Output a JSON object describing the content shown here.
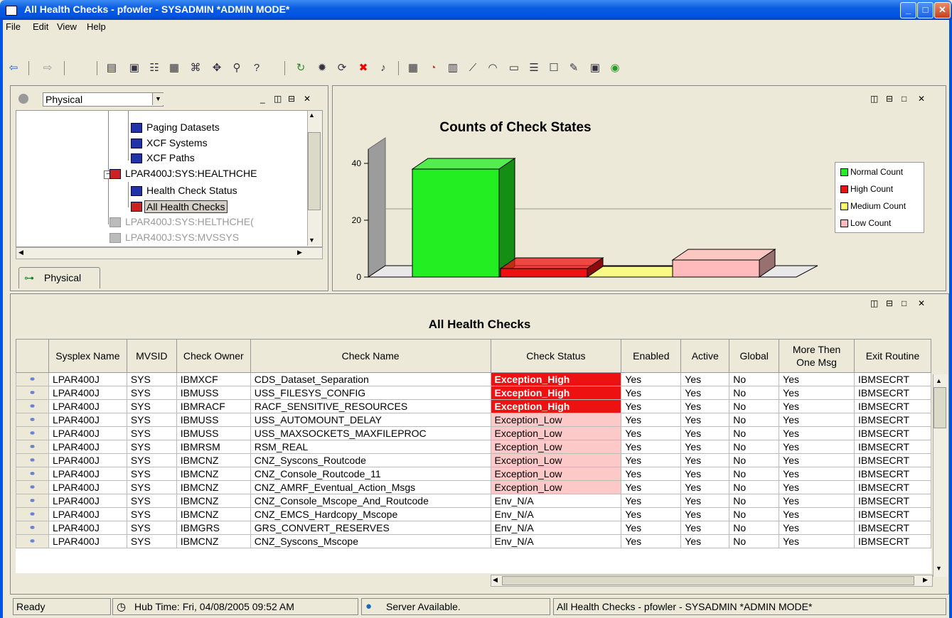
{
  "window": {
    "title": "All Health Checks - pfowler - SYSADMIN   *ADMIN MODE*"
  },
  "menu": [
    "File",
    "Edit",
    "View",
    "Help"
  ],
  "toolbar": {
    "icons": [
      "back-icon",
      "forward-icon",
      "new-icon",
      "save-icon",
      "properties-icon",
      "calendar-icon",
      "link-icon",
      "move-icon",
      "find-icon",
      "help-icon",
      "refresh-icon",
      "stop-icon",
      "reload-icon",
      "error-icon",
      "sound-icon",
      "table-icon",
      "pie-chart-icon",
      "bar-chart-icon",
      "line-chart-icon",
      "gauge-icon",
      "graph-icon",
      "report-icon",
      "notepad-icon",
      "edit-icon",
      "terminal-icon",
      "globe-icon"
    ]
  },
  "tree_panel": {
    "view": "Physical",
    "items": [
      {
        "label": "Paging Datasets",
        "state": "normal"
      },
      {
        "label": "XCF Systems",
        "state": "normal"
      },
      {
        "label": "XCF Paths",
        "state": "normal"
      },
      {
        "label": "LPAR400J:SYS:HEALTHCHE",
        "state": "normal"
      },
      {
        "label": "Health Check Status",
        "state": "normal"
      },
      {
        "label": "All Health Checks",
        "state": "selected"
      },
      {
        "label": "LPAR400J:SYS:HELTHCHE(",
        "state": "disabled"
      },
      {
        "label": "LPAR400J:SYS:MVSSYS",
        "state": "disabled"
      }
    ],
    "tab": "Physical"
  },
  "chart_data": {
    "type": "bar",
    "title": "Counts of Check States",
    "categories": [
      "Normal Count",
      "High Count",
      "Medium Count",
      "Low Count"
    ],
    "values": [
      38,
      3,
      0,
      6
    ],
    "colors": [
      "#22ee22",
      "#ee1111",
      "#ffff66",
      "#ffbbbb"
    ],
    "ylim": [
      0,
      45
    ],
    "yticks": [
      0,
      20,
      40
    ],
    "legend": [
      "Normal Count",
      "High Count",
      "Medium Count",
      "Low Count"
    ],
    "legend_position": "right",
    "grid": true
  },
  "table": {
    "title": "All Health Checks",
    "columns": [
      "",
      "Sysplex Name",
      "MVSID",
      "Check Owner",
      "Check Name",
      "Check Status",
      "Enabled",
      "Active",
      "Global",
      "More Then One Msg",
      "Exit Routine"
    ],
    "rows": [
      [
        "LPAR400J",
        "SYS",
        "IBMXCF",
        "CDS_Dataset_Separation",
        "Exception_High",
        "Yes",
        "Yes",
        "No",
        "Yes",
        "IBMSECRT"
      ],
      [
        "LPAR400J",
        "SYS",
        "IBMUSS",
        "USS_FILESYS_CONFIG",
        "Exception_High",
        "Yes",
        "Yes",
        "No",
        "Yes",
        "IBMSECRT"
      ],
      [
        "LPAR400J",
        "SYS",
        "IBMRACF",
        "RACF_SENSITIVE_RESOURCES",
        "Exception_High",
        "Yes",
        "Yes",
        "No",
        "Yes",
        "IBMSECRT"
      ],
      [
        "LPAR400J",
        "SYS",
        "IBMUSS",
        "USS_AUTOMOUNT_DELAY",
        "Exception_Low",
        "Yes",
        "Yes",
        "No",
        "Yes",
        "IBMSECRT"
      ],
      [
        "LPAR400J",
        "SYS",
        "IBMUSS",
        "USS_MAXSOCKETS_MAXFILEPROC",
        "Exception_Low",
        "Yes",
        "Yes",
        "No",
        "Yes",
        "IBMSECRT"
      ],
      [
        "LPAR400J",
        "SYS",
        "IBMRSM",
        "RSM_REAL",
        "Exception_Low",
        "Yes",
        "Yes",
        "No",
        "Yes",
        "IBMSECRT"
      ],
      [
        "LPAR400J",
        "SYS",
        "IBMCNZ",
        "CNZ_Syscons_Routcode",
        "Exception_Low",
        "Yes",
        "Yes",
        "No",
        "Yes",
        "IBMSECRT"
      ],
      [
        "LPAR400J",
        "SYS",
        "IBMCNZ",
        "CNZ_Console_Routcode_11",
        "Exception_Low",
        "Yes",
        "Yes",
        "No",
        "Yes",
        "IBMSECRT"
      ],
      [
        "LPAR400J",
        "SYS",
        "IBMCNZ",
        "CNZ_AMRF_Eventual_Action_Msgs",
        "Exception_Low",
        "Yes",
        "Yes",
        "No",
        "Yes",
        "IBMSECRT"
      ],
      [
        "LPAR400J",
        "SYS",
        "IBMCNZ",
        "CNZ_Console_Mscope_And_Routcode",
        "Env_N/A",
        "Yes",
        "Yes",
        "No",
        "Yes",
        "IBMSECRT"
      ],
      [
        "LPAR400J",
        "SYS",
        "IBMCNZ",
        "CNZ_EMCS_Hardcopy_Mscope",
        "Env_N/A",
        "Yes",
        "Yes",
        "No",
        "Yes",
        "IBMSECRT"
      ],
      [
        "LPAR400J",
        "SYS",
        "IBMGRS",
        "GRS_CONVERT_RESERVES",
        "Env_N/A",
        "Yes",
        "Yes",
        "No",
        "Yes",
        "IBMSECRT"
      ],
      [
        "LPAR400J",
        "SYS",
        "IBMCNZ",
        "CNZ_Syscons_Mscope",
        "Env_N/A",
        "Yes",
        "Yes",
        "No",
        "Yes",
        "IBMSECRT"
      ]
    ]
  },
  "statusbar": {
    "status": "Ready",
    "hub_time": "Hub Time: Fri, 04/08/2005 09:52 AM",
    "server": "Server Available.",
    "window_info": "All Health Checks - pfowler - SYSADMIN   *ADMIN MODE*"
  }
}
